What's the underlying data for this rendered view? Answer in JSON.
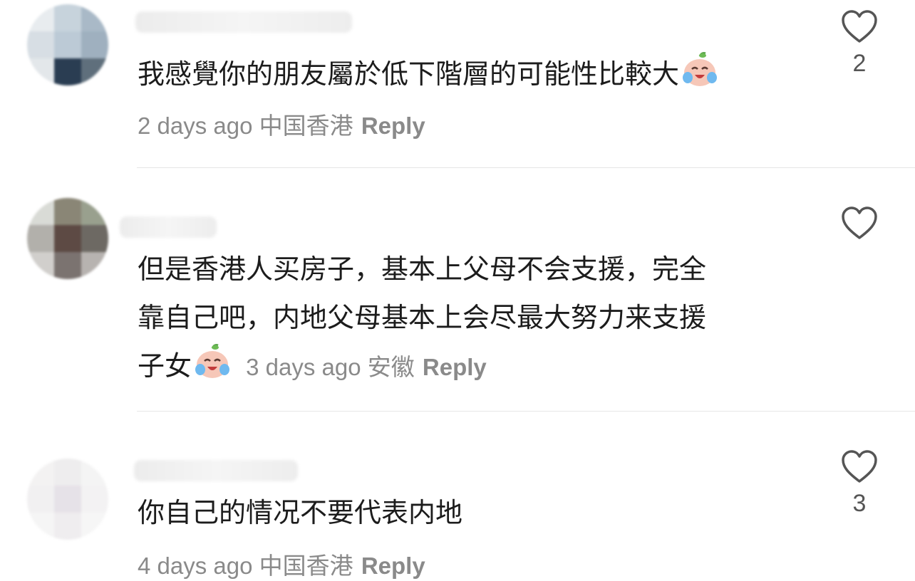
{
  "comments": [
    {
      "text": "我感覺你的朋友屬於低下階層的可能性比較大",
      "time": "2 days ago",
      "location": "中国香港",
      "reply_label": "Reply",
      "likes": "2",
      "emoji": "crying-laughing-face-icon"
    },
    {
      "text_line1": "但是香港人买房子，基本上父母不会支援，完全",
      "text_line2": "靠自己吧，内地父母基本上会尽最大努力来支援",
      "text_line3": "子女",
      "time": "3 days ago",
      "location": "安徽",
      "reply_label": "Reply",
      "likes": "",
      "emoji": "crying-laughing-face-icon"
    },
    {
      "text": "你自己的情况不要代表内地",
      "time": "4 days ago",
      "location": "中国香港",
      "reply_label": "Reply",
      "likes": "3"
    }
  ],
  "colors": {
    "text": "#1c1c1c",
    "meta": "#8a8a8a",
    "divider": "#e6e6e6",
    "heart": "#555555"
  }
}
